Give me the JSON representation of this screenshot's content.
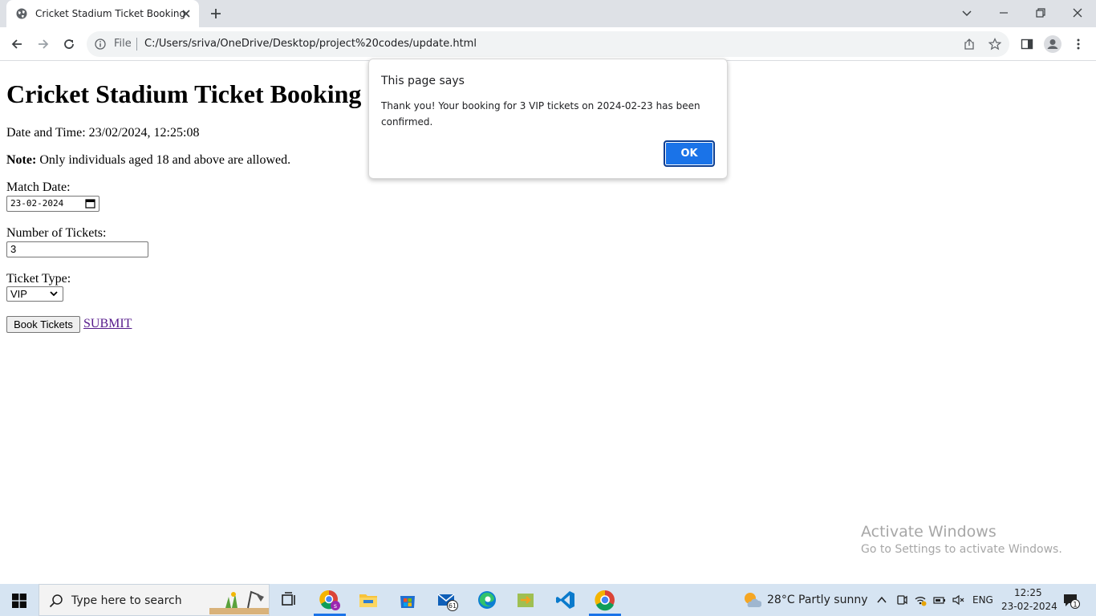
{
  "browser": {
    "tab_title": "Cricket Stadium Ticket Booking",
    "omnibox_prefix": "File",
    "url": "C:/Users/sriva/OneDrive/Desktop/project%20codes/update.html"
  },
  "page": {
    "heading": "Cricket Stadium Ticket Booking",
    "datetime": "Date and Time: 23/02/2024, 12:25:08",
    "note_label": "Note:",
    "note_text": " Only individuals aged 18 and above are allowed.",
    "match_date_label": "Match Date:",
    "match_date_value": "23-02-2024",
    "tickets_label": "Number of Tickets:",
    "tickets_value": "3",
    "ticket_type_label": "Ticket Type:",
    "ticket_type_value": "VIP",
    "book_button": "Book Tickets",
    "submit_link": "SUBMIT"
  },
  "dialog": {
    "title": "This page says",
    "message": "Thank you! Your booking for 3 VIP tickets on 2024-02-23 has been confirmed.",
    "ok_button": "OK"
  },
  "watermark": {
    "line1": "Activate Windows",
    "line2": "Go to Settings to activate Windows."
  },
  "taskbar": {
    "search_placeholder": "Type here to search",
    "mail_badge": "61",
    "weather": "28°C  Partly sunny",
    "language": "ENG",
    "time": "12:25",
    "date": "23-02-2024",
    "notification_count": "1"
  },
  "colors": {
    "accent": "#1a73e8",
    "visited_link": "#551a8b",
    "taskbar": "#d6e4f2"
  }
}
